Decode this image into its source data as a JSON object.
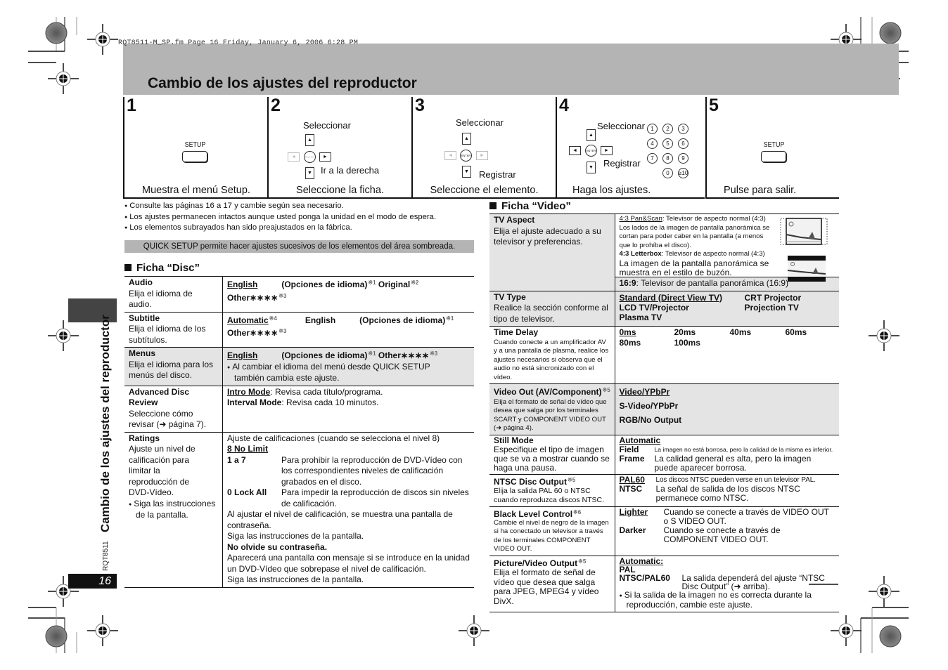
{
  "print_header": "RQT8511-M_SP.fm  Page 16  Friday, January 6, 2006  6:28 PM",
  "page_title": "Cambio de los ajustes del reproductor",
  "steps": [
    {
      "number": "1",
      "button_label": "SETUP",
      "caption": "Muestra el menú Setup."
    },
    {
      "number": "2",
      "label_select": "Seleccionar",
      "label_right": "Ir a la derecha",
      "caption": "Seleccione la ficha."
    },
    {
      "number": "3",
      "label_select": "Seleccionar",
      "label_enter": "Registrar",
      "caption": "Seleccione el elemento."
    },
    {
      "number": "4",
      "label_select": "Seleccionar",
      "label_enter": "Registrar",
      "numeric_keys": [
        "1",
        "2",
        "3",
        "4",
        "5",
        "6",
        "7",
        "8",
        "9",
        "0",
        "≥10"
      ],
      "caption": "Haga los ajustes."
    },
    {
      "number": "5",
      "button_label": "SETUP",
      "caption": "Pulse para salir."
    }
  ],
  "remote_keys": {
    "enter": "ENTER",
    "up": "▲",
    "down": "▼",
    "left": "◄",
    "right": "►"
  },
  "notes": [
    "Consulte las páginas 16 a 17 y cambie según sea necesario.",
    "Los ajustes permanecen intactos aunque usted ponga la unidad en el modo de espera.",
    "Los elementos subrayados han sido preajustados en la fábrica."
  ],
  "quick_setup_note": "QUICK SETUP permite hacer ajustes sucesivos de los elementos del área sombreada.",
  "disc_tab": {
    "heading": "Ficha “Disc”",
    "rows": [
      {
        "name": "Audio",
        "desc": "Elija el idioma de audio.",
        "opt1": "English",
        "opt2": "(Opciones de idioma)",
        "opt2_sup": "※1",
        "opt3": "Original",
        "opt3_sup": "※2",
        "opt4": "Other∗∗∗∗",
        "opt4_sup": "※3"
      },
      {
        "name": "Subtitle",
        "desc": "Elija el idioma de los subtítulos.",
        "opt1": "Automatic",
        "opt1_sup": "※4",
        "opt2": "English",
        "opt3": "(Opciones de idioma)",
        "opt3_sup": "※1",
        "opt4": "Other∗∗∗∗",
        "opt4_sup": "※3"
      },
      {
        "name": "Menus",
        "desc": "Elija el idioma para los menús del disco.",
        "opt1": "English",
        "opt2": "(Opciones de idioma)",
        "opt2_sup": "※1",
        "opt3": "Other∗∗∗∗",
        "opt3_sup": "※3",
        "note": "Al cambiar el idioma del menú desde QUICK SETUP también cambia este ajuste."
      },
      {
        "name": "Advanced Disc Review",
        "desc": "Seleccione cómo revisar (➜ página 7).",
        "opt1": "Intro Mode",
        "opt1_text": ": Revisa cada título/programa.",
        "opt2": "Interval Mode",
        "opt2_text": ": Revisa cada 10 minutos."
      },
      {
        "name": "Ratings",
        "desc": "Ajuste un nivel de calificación para limitar la reproducción de DVD-Vídeo.",
        "desc_note": "Siga las instrucciones de la pantalla.",
        "intro": "Ajuste de calificaciones (cuando se selecciona el nivel 8)",
        "default": "8 No Limit",
        "levels": [
          {
            "key": "1 a 7",
            "text": "Para prohibir la reproducción de DVD-Vídeo con los correspondientes niveles de calificación grabados en el disco."
          },
          {
            "key": "0 Lock All",
            "text": "Para impedir la reproducción de discos sin niveles de calificación."
          }
        ],
        "p1": "Al ajustar el nivel de calificación, se muestra una pantalla de contraseña.",
        "p2": "Siga las instrucciones de la pantalla.",
        "p3": "No olvide su contraseña.",
        "p4": "Aparecerá una pantalla con mensaje si se introduce en la unidad un DVD-Vídeo que sobrepase el nivel de calificación.",
        "p5": "Siga las instrucciones de la pantalla."
      }
    ]
  },
  "video_tab": {
    "heading": "Ficha “Video”",
    "tv_aspect": {
      "name": "TV Aspect",
      "desc": "Elija el ajuste adecuado a su televisor y preferencias.",
      "ps_key": "4:3 Pan&Scan",
      "ps_text": ": Televisor de aspecto normal (4:3)",
      "ps_desc": "Los lados de la imagen de pantalla panorámica se cortan para poder caber en la pantalla (a menos que lo prohíba el disco).",
      "lb_key": "4:3 Letterbox",
      "lb_text": ": Televisor de aspecto normal (4:3)",
      "lb_desc": "La imagen de la pantalla panorámica se muestra en el estilo de buzón.",
      "wide_key": "16:9",
      "wide_text": ": Televisor de pantalla panorámica (16:9)"
    },
    "tv_type": {
      "name": "TV Type",
      "desc": "Realice la sección conforme al tipo de televisor.",
      "options": [
        "Standard (Direct View TV)",
        "CRT Projector",
        "LCD TV/Projector",
        "Projection TV",
        "Plasma TV"
      ]
    },
    "time_delay": {
      "name": "Time Delay",
      "desc": "Cuando conecte a un amplificador AV y a una pantalla de plasma, realice los ajustes necesarios si observa que el audio no está sincronizado con el vídeo.",
      "options": [
        "0ms",
        "20ms",
        "40ms",
        "60ms",
        "80ms",
        "100ms"
      ]
    },
    "video_out": {
      "name": "Video Out (AV/Component)",
      "sup": "※5",
      "desc": "Elija el formato de señal de vídeo que desea que salga por los terminales SCART  y COMPONENT VIDEO OUT (➜ página 4).",
      "options": [
        "Video/YPbPr",
        "S-Video/YPbPr",
        "RGB/No Output"
      ]
    },
    "still_mode": {
      "name": "Still Mode",
      "desc": "Especifique el tipo de imagen que se va a mostrar cuando se haga una pausa.",
      "default": "Automatic",
      "field_key": "Field",
      "field_text": "La imagen no está borrosa, pero la calidad de la misma es inferior.",
      "frame_key": "Frame",
      "frame_text": "La calidad general es alta, pero la imagen puede aparecer borrosa."
    },
    "ntsc_out": {
      "name": "NTSC Disc Output",
      "sup": "※5",
      "desc": "Elija la salida PAL 60 o NTSC cuando reproduzca discos NTSC.",
      "pal_key": "PAL60",
      "pal_text": "Los discos NTSC pueden verse en un televisor PAL.",
      "ntsc_key": "NTSC",
      "ntsc_text": "La señal de salida de los discos NTSC permanece como NTSC."
    },
    "black_level": {
      "name": "Black Level Control",
      "sup": "※6",
      "desc": "Cambie el nivel de negro de la imagen si ha conectado un televisor a través de los terminales COMPONENT VIDEO OUT.",
      "lighter_key": "Lighter",
      "lighter_text": "Cuando se conecte a través de VIDEO OUT o S VIDEO OUT.",
      "darker_key": "Darker",
      "darker_text": "Cuando se conecte a través de COMPONENT VIDEO OUT."
    },
    "picture_out": {
      "name": "Picture/Video Output",
      "sup": "※5",
      "desc": "Elija el formato de señal de vídeo que desea que salga para JPEG, MPEG4 y vídeo DivX.",
      "default": "Automatic:",
      "opt2": "PAL",
      "opt3_key": "NTSC/PAL60",
      "opt3_text": "La salida dependerá del ajuste “NTSC Disc Output” (➜ arriba).",
      "note": "Si la salida de la imagen no es correcta durante la reproducción, cambie este ajuste."
    }
  },
  "side_tab_text": "Cambio de los ajustes del reproductor",
  "side_code": "RQT8511",
  "page_number": "16",
  "colors": {
    "band": "#b4b4b4",
    "shade": "#e4e4e4",
    "dark_tab": "#444444"
  }
}
